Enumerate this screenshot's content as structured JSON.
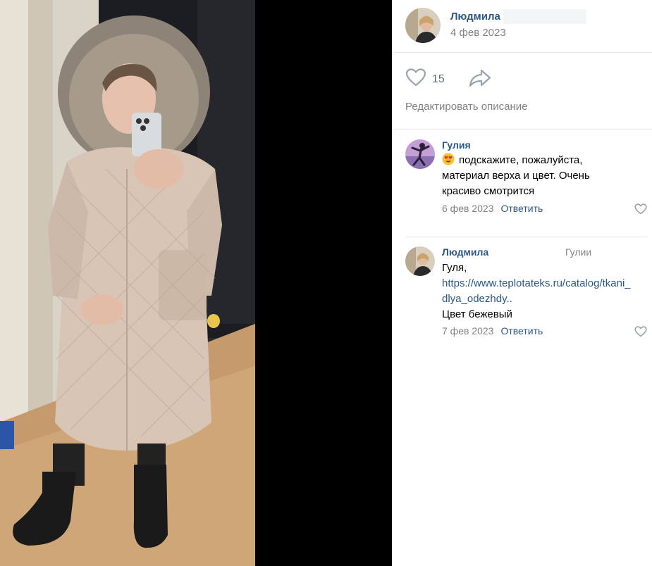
{
  "post": {
    "author": "Людмила",
    "date": "4 фев 2023",
    "likes": "15",
    "edit_label": "Редактировать описание"
  },
  "comments": [
    {
      "author": "Гулия",
      "emoji": "heart-eyes-emoji",
      "text": "подскажите, пожалуйста, материал верха и цвет. Очень красиво смотрится",
      "date": "6 фев 2023",
      "reply_label": "Ответить"
    },
    {
      "author": "Людмила",
      "reply_to": "Гулии",
      "line1": "Гуля,",
      "link": "https://www.teplotateks.ru/catalog/tkani_dlya_odezhdy..",
      "line3": "Цвет бежевый",
      "date": "7 фев 2023",
      "reply_label": "Ответить"
    }
  ],
  "icons": {
    "like": "heart-icon",
    "share": "share-arrow-icon",
    "comment_like": "heart-outline-icon"
  },
  "colors": {
    "link": "#2a5885",
    "muted": "#828282",
    "divider": "#e7e8ec",
    "photo_bg": "#000000"
  }
}
